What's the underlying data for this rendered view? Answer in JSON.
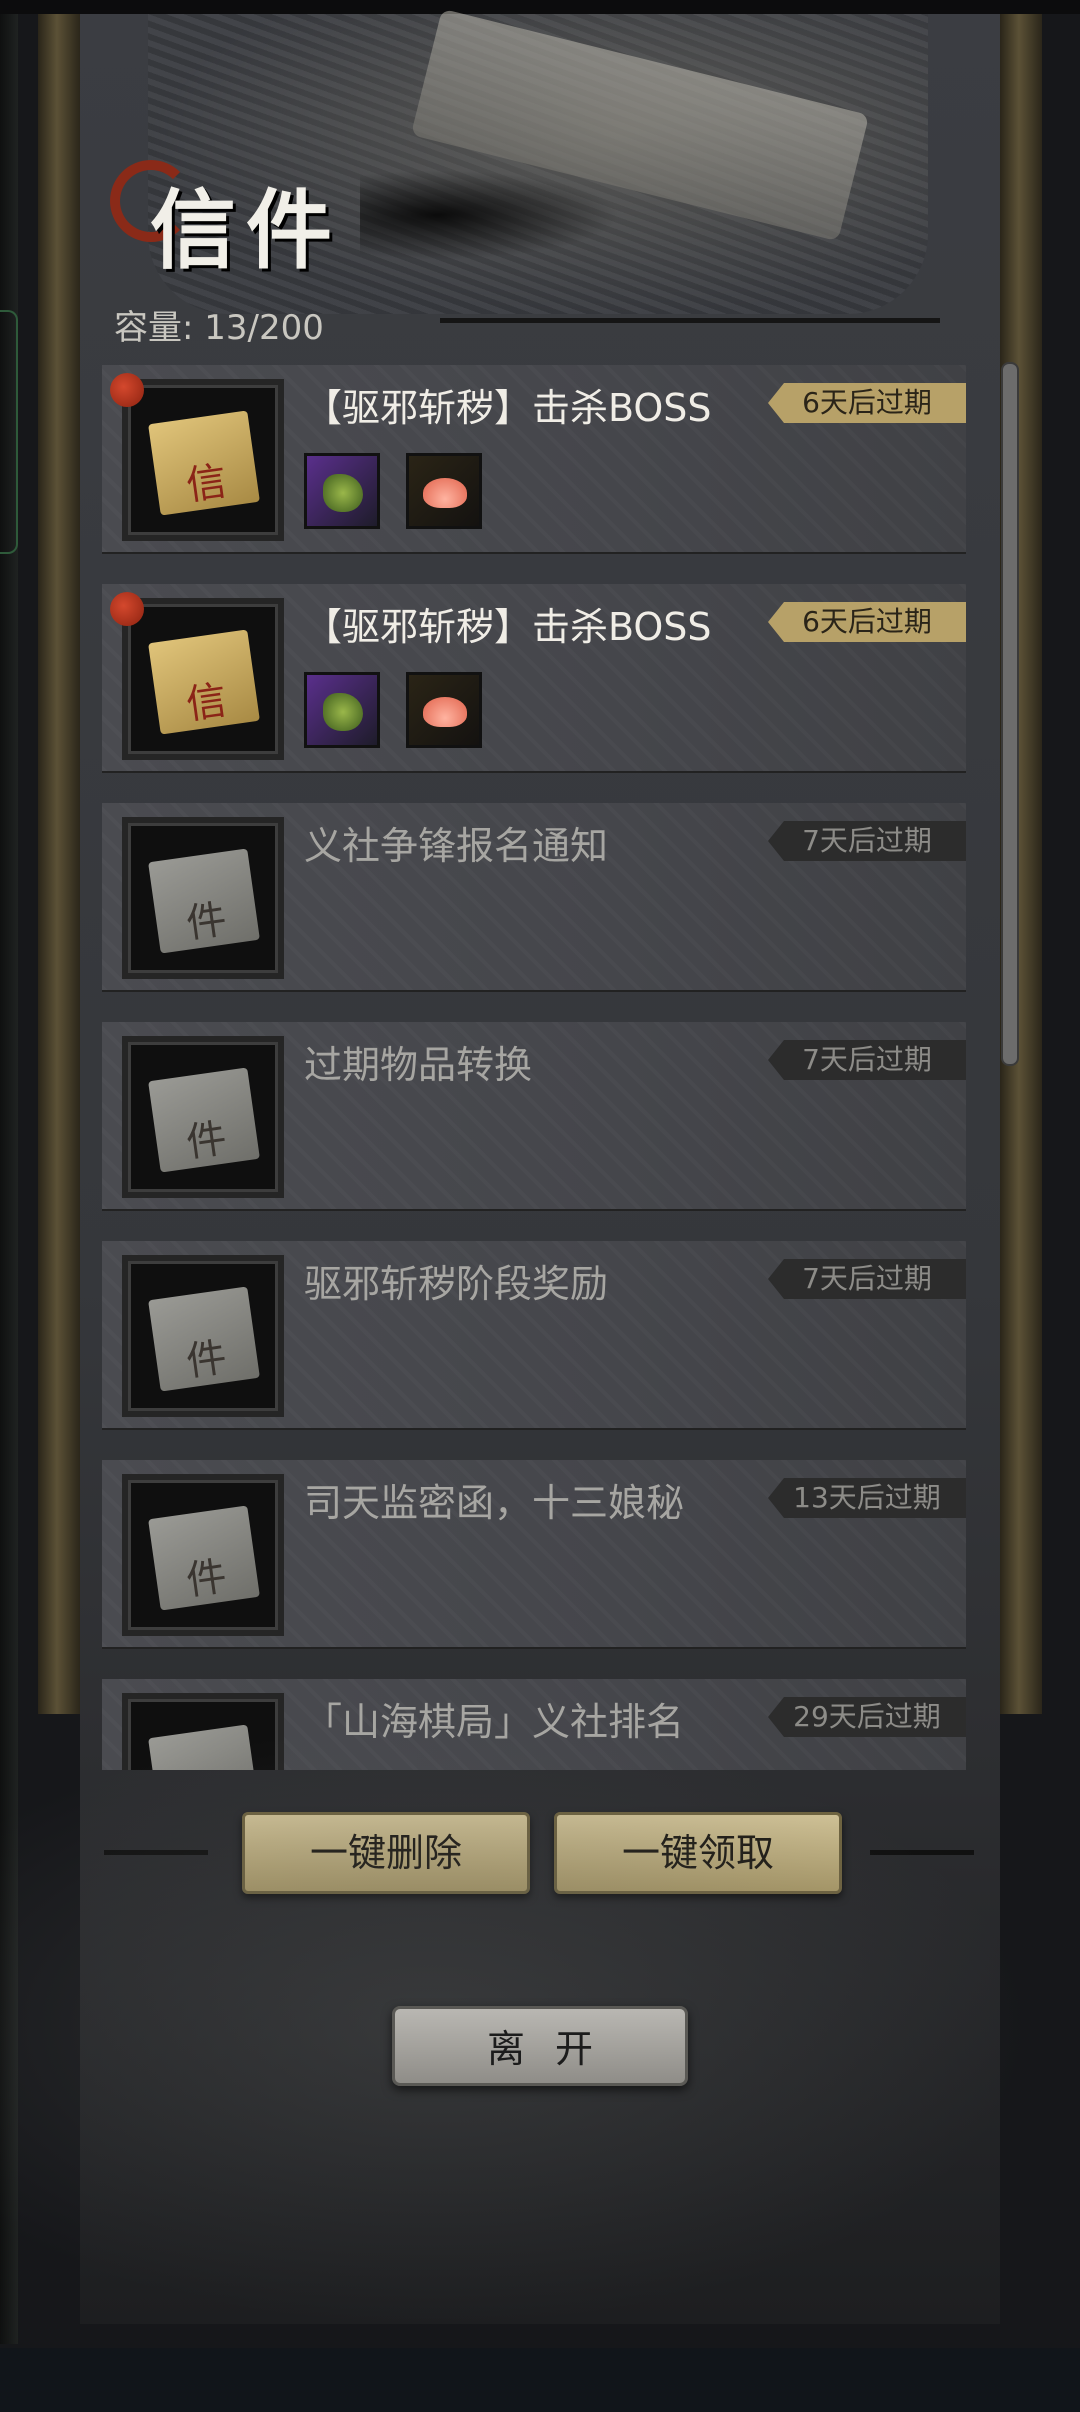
{
  "header": {
    "title": "信件",
    "capacity_label": "容量: 13/200"
  },
  "mails": [
    {
      "title": "【驱邪斩秽】击杀BOSS",
      "expire": "6天后过期",
      "unread": true,
      "thumb_char": "信",
      "rewards": [
        "dragon-helm-icon",
        "lotus-lantern-icon"
      ]
    },
    {
      "title": "【驱邪斩秽】击杀BOSS",
      "expire": "6天后过期",
      "unread": true,
      "thumb_char": "信",
      "rewards": [
        "dragon-helm-icon",
        "lotus-lantern-icon"
      ]
    },
    {
      "title": "义社争锋报名通知",
      "expire": "7天后过期",
      "unread": false,
      "thumb_char": "件",
      "rewards": []
    },
    {
      "title": "过期物品转换",
      "expire": "7天后过期",
      "unread": false,
      "thumb_char": "件",
      "rewards": []
    },
    {
      "title": "驱邪斩秽阶段奖励",
      "expire": "7天后过期",
      "unread": false,
      "thumb_char": "件",
      "rewards": []
    },
    {
      "title": "司天监密函，十三娘秘",
      "expire": "13天后过期",
      "unread": false,
      "thumb_char": "件",
      "rewards": []
    },
    {
      "title": "「山海棋局」义社排名",
      "expire": "29天后过期",
      "unread": false,
      "thumb_char": "件",
      "rewards": []
    }
  ],
  "actions": {
    "delete_all": "一键删除",
    "claim_all": "一键领取",
    "leave": "离开"
  },
  "colors": {
    "accent_gold": "#b7a168",
    "unread_dot": "#c9412a",
    "panel": "#3b3d42"
  }
}
